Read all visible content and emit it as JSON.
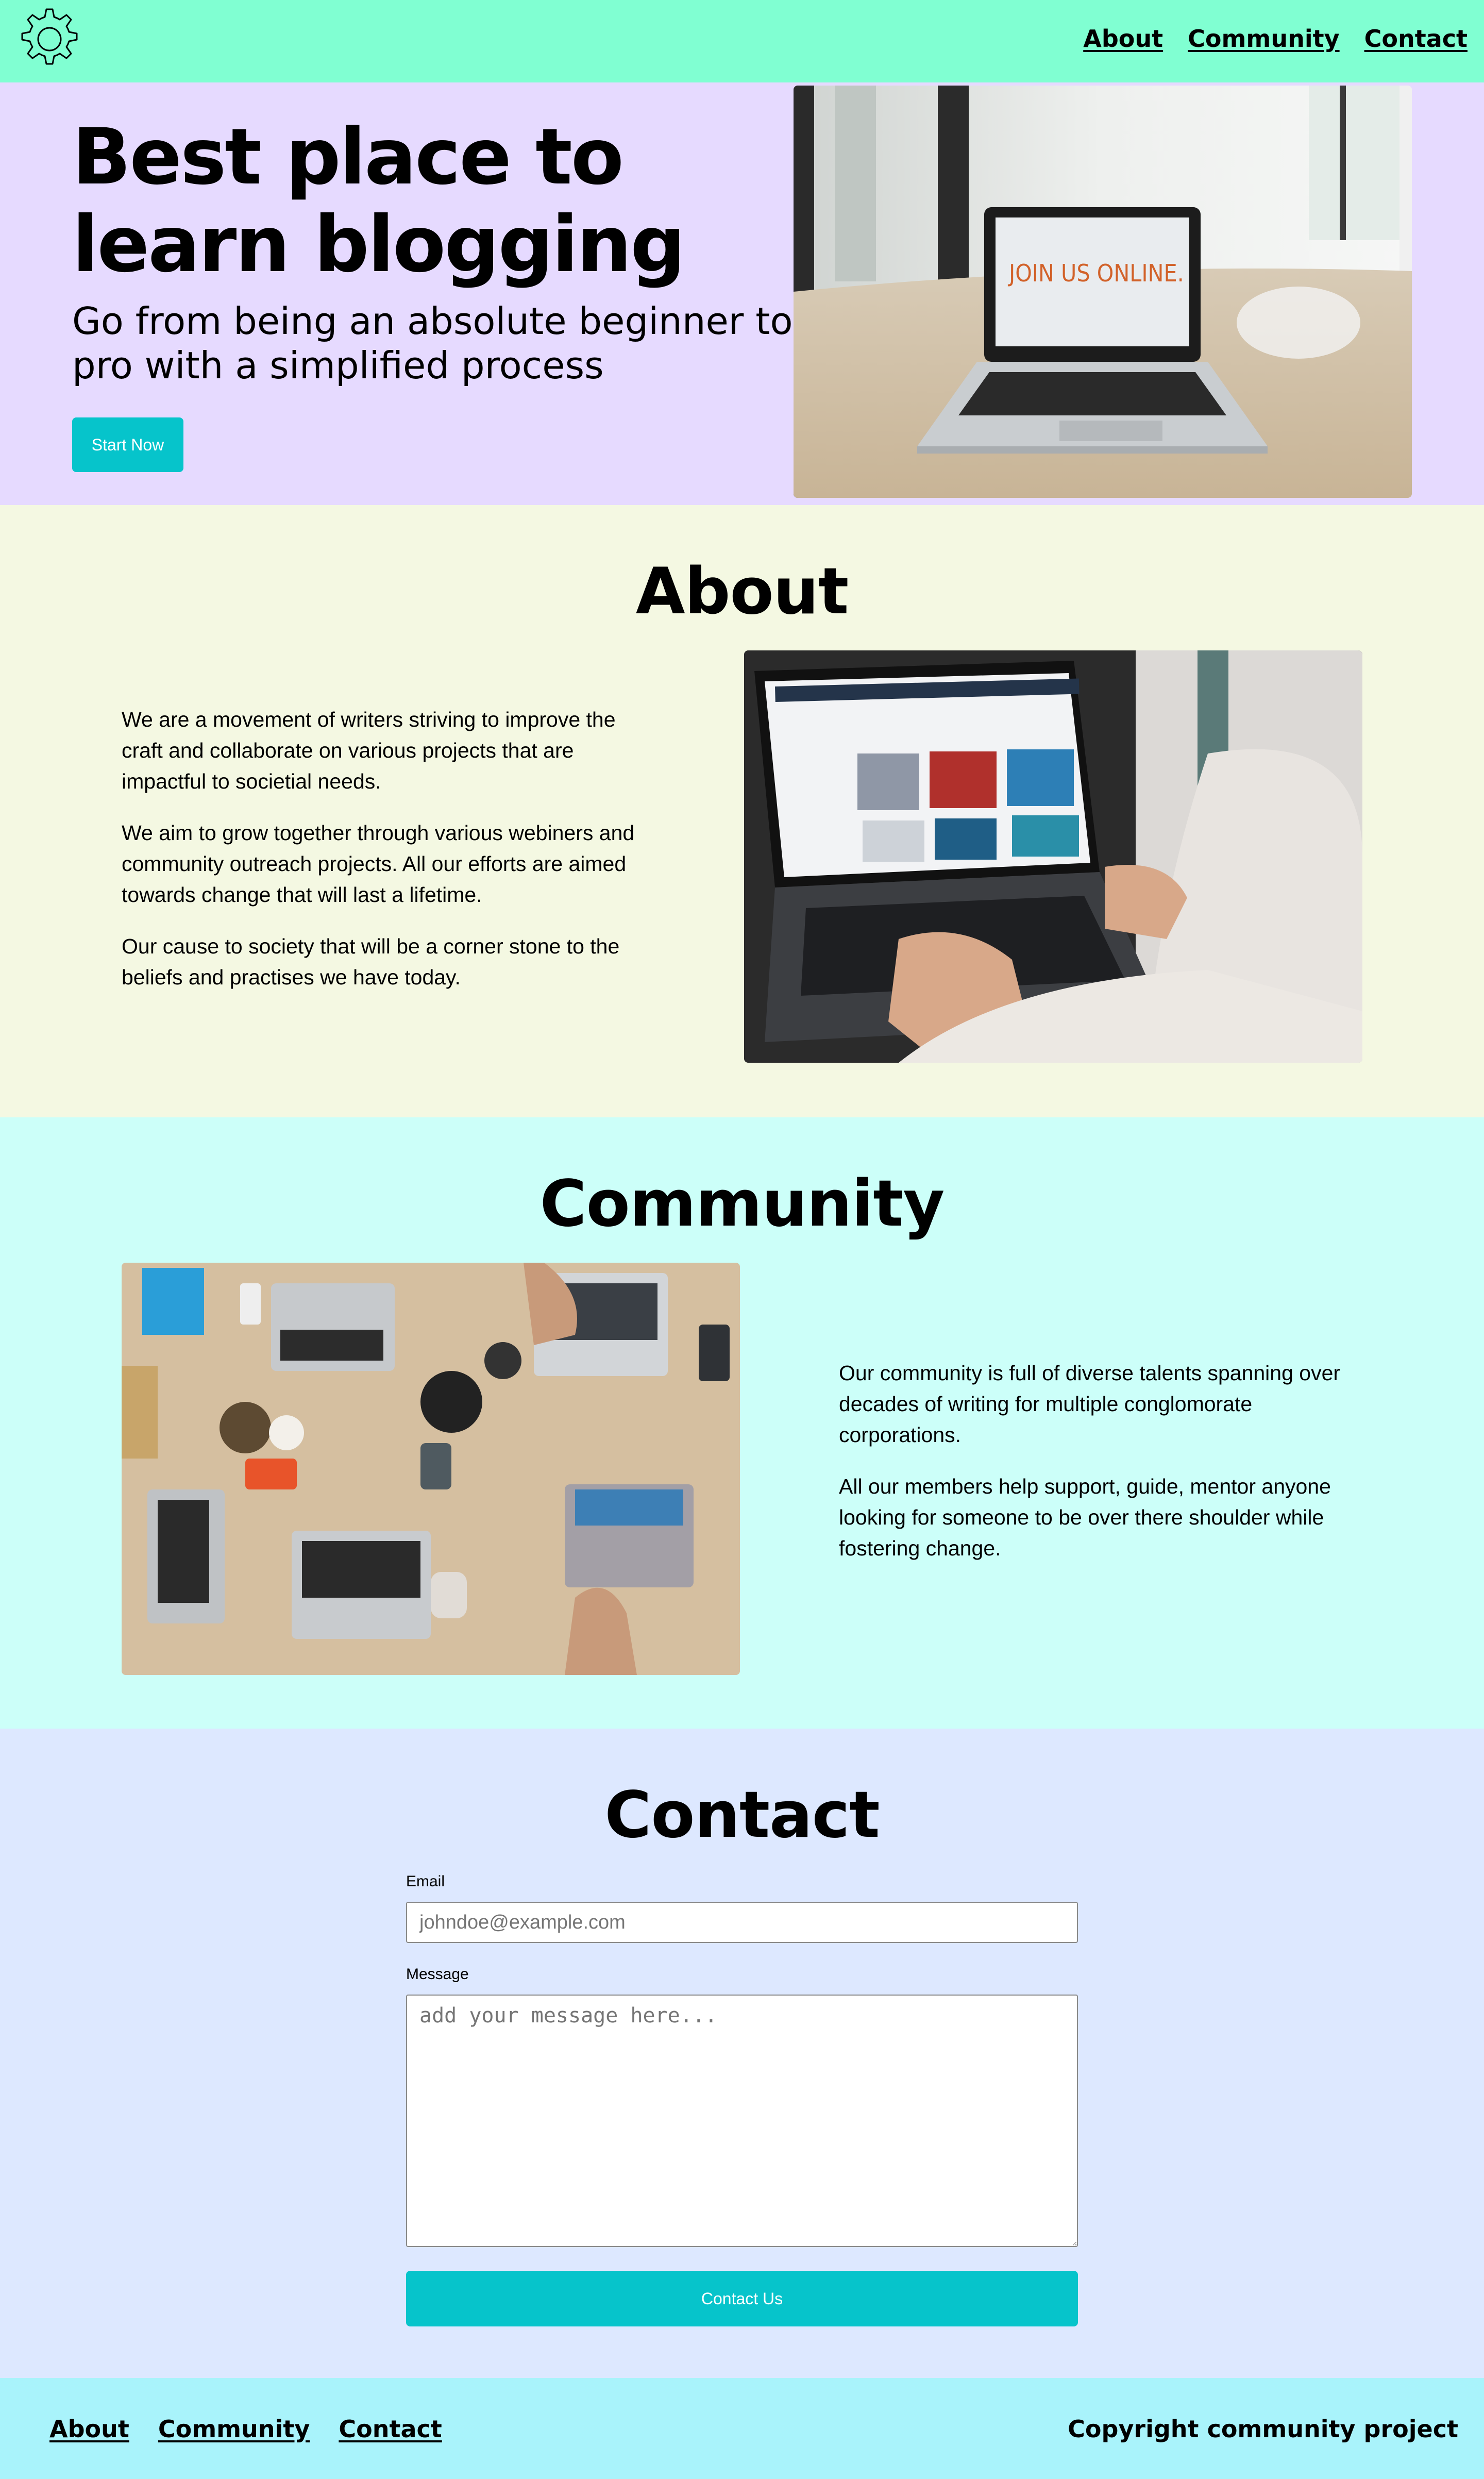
{
  "header": {
    "logo_icon": "gear-icon",
    "nav": [
      "About",
      "Community",
      "Contact"
    ]
  },
  "hero": {
    "title": "Best place to learn blogging",
    "subtitle": "Go from being an absolute beginner to pro with a simplified process",
    "cta_label": "Start Now",
    "image_screen_text": "JOIN US ONLINE."
  },
  "about": {
    "title": "About",
    "paragraphs": [
      "We are a movement of writers striving to improve the craft and collaborate on various projects that are impactful to societial needs.",
      "We aim to grow together through various webiners and community outreach projects. All our efforts are aimed towards change that will last a lifetime.",
      "Our cause to society that will be a corner stone to the beliefs and practises we have today."
    ]
  },
  "community": {
    "title": "Community",
    "paragraphs": [
      "Our community is full of diverse talents spanning over decades of writing for multiple conglomorate corporations.",
      "All our members help support, guide, mentor anyone looking for someone to be over there shoulder while fostering change."
    ]
  },
  "contact": {
    "title": "Contact",
    "email_label": "Email",
    "email_placeholder": "johndoe@example.com",
    "message_label": "Message",
    "message_placeholder": "add your message here...",
    "submit_label": "Contact Us"
  },
  "footer": {
    "nav": [
      "About",
      "Community",
      "Contact"
    ],
    "copyright": "Copyright community project"
  },
  "colors": {
    "header_bg": "#80ffd2",
    "hero_bg": "#e6daff",
    "about_bg": "#f4f8e2",
    "community_bg": "#ccfff9",
    "contact_bg": "#dde8ff",
    "footer_bg": "#a9f3fb",
    "button": "#06c4cb"
  }
}
